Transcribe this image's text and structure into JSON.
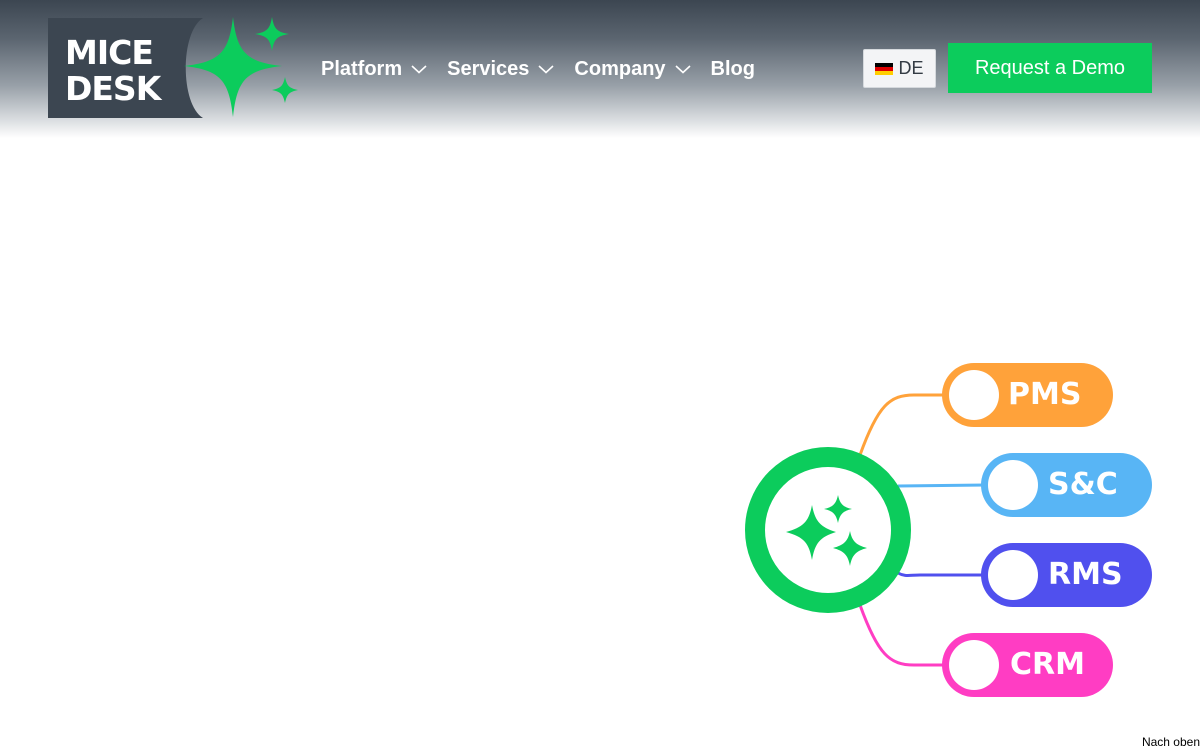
{
  "brand": {
    "logo_line1": "MICE",
    "logo_line2": "DESK",
    "accent_color": "#0ccc5c",
    "logo_dark_color": "#3c4651"
  },
  "nav": {
    "items": [
      {
        "label": "Platform",
        "has_dropdown": true
      },
      {
        "label": "Services",
        "has_dropdown": true
      },
      {
        "label": "Company",
        "has_dropdown": true
      },
      {
        "label": "Blog",
        "has_dropdown": false
      }
    ],
    "dropdown_icon": "chevron-down-icon"
  },
  "language": {
    "label": "DE",
    "flag_icon": "german-flag-icon"
  },
  "cta": {
    "label": "Request a Demo",
    "color": "#0ccc5c"
  },
  "diagram": {
    "hub_icon": "sparkles-icon",
    "hub_color": "#0ccc5c",
    "nodes": [
      {
        "label": "PMS",
        "color": "#ffa23a"
      },
      {
        "label": "S&C",
        "color": "#58b5f5"
      },
      {
        "label": "RMS",
        "color": "#5050ee"
      },
      {
        "label": "CRM",
        "color": "#ff3dc3"
      }
    ]
  },
  "footer": {
    "back_to_top": "Nach oben"
  }
}
